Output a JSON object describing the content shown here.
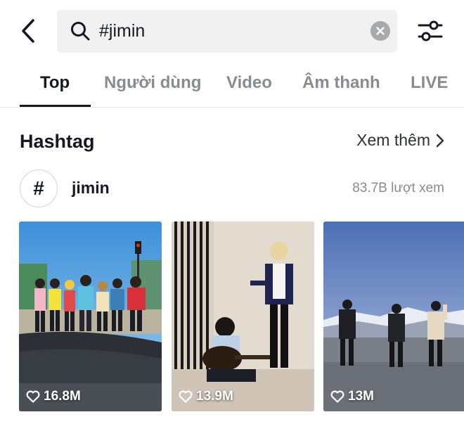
{
  "search": {
    "query": "#jimin"
  },
  "tabs": [
    {
      "label": "Top",
      "active": true
    },
    {
      "label": "Người dùng",
      "active": false
    },
    {
      "label": "Video",
      "active": false
    },
    {
      "label": "Âm thanh",
      "active": false
    },
    {
      "label": "LIVE",
      "active": false
    }
  ],
  "hashtag_section": {
    "title": "Hashtag",
    "see_more": "Xem thêm",
    "hashtag": {
      "symbol": "#",
      "name": "jimin",
      "views": "83.7B lượt xem"
    }
  },
  "videos": [
    {
      "likes": "16.8M"
    },
    {
      "likes": "13.9M"
    },
    {
      "likes": "13M"
    }
  ],
  "colors": {
    "text_primary": "#161823",
    "text_secondary": "#8a8b91",
    "search_bg": "#f1f1f2"
  }
}
